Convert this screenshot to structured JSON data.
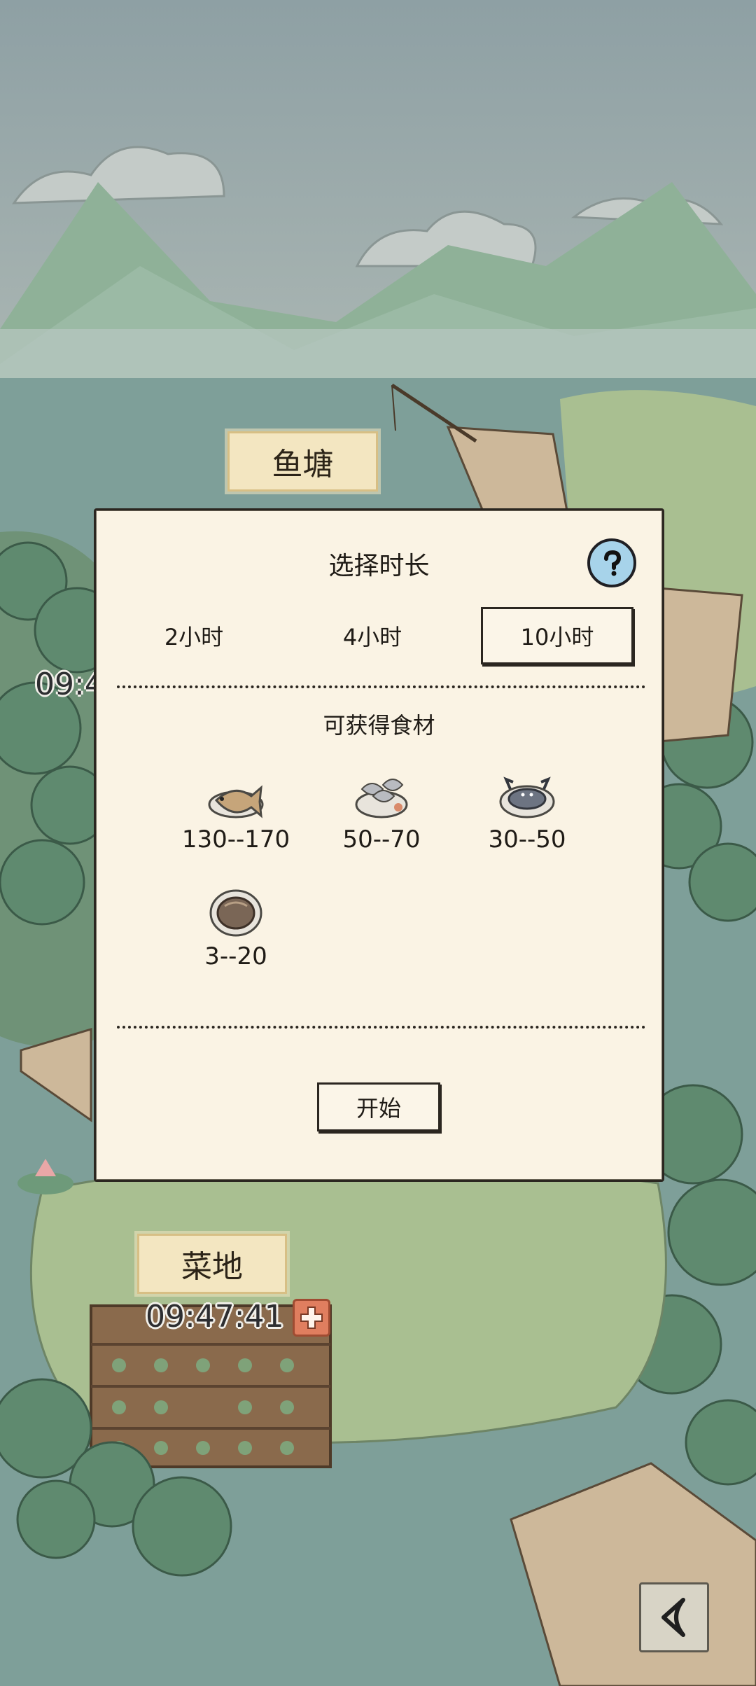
{
  "scene": {
    "pond_sign": "鱼塘",
    "farm_sign": "菜地",
    "left_timer": "09:4",
    "farm_timer": "09:47:41"
  },
  "icons": {
    "help": "question-mark-icon",
    "plus": "plus-icon",
    "back": "back-arrow-icon"
  },
  "modal": {
    "title": "选择时长",
    "durations": [
      {
        "label": "2小时",
        "selected": false
      },
      {
        "label": "4小时",
        "selected": false
      },
      {
        "label": "10小时",
        "selected": true
      }
    ],
    "subtitle": "可获得食材",
    "items": [
      {
        "icon": "fish-icon",
        "range": "130--170"
      },
      {
        "icon": "shrimp-icon",
        "range": "50--70"
      },
      {
        "icon": "crab-icon",
        "range": "30--50"
      },
      {
        "icon": "clam-icon",
        "range": "3--20"
      }
    ],
    "start_label": "开始"
  },
  "colors": {
    "panel": "#faf3e4",
    "border": "#2b2620",
    "help": "#a7d3ea",
    "plus": "#e07e5f"
  }
}
